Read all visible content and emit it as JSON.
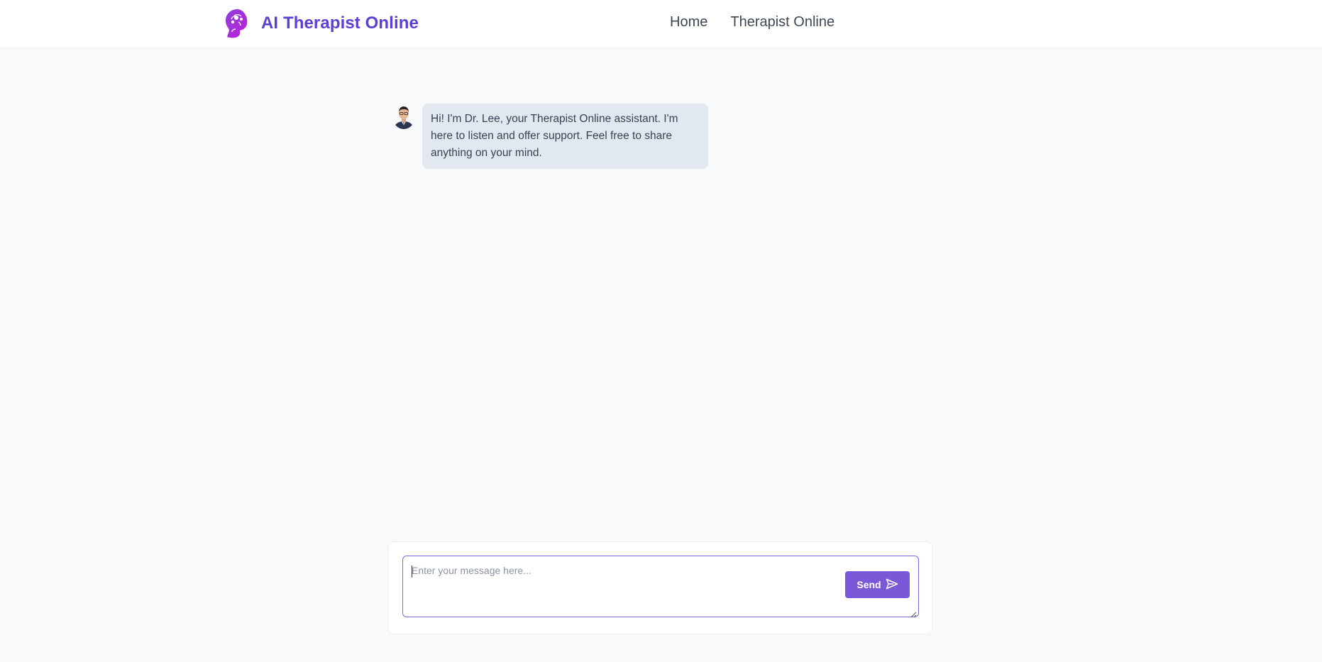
{
  "header": {
    "brand_title": "AI Therapist Online",
    "logo_icon": "brain-head-icon",
    "nav": [
      {
        "label": "Home"
      },
      {
        "label": "Therapist Online"
      }
    ]
  },
  "chat": {
    "messages": [
      {
        "sender": "assistant",
        "avatar_icon": "therapist-avatar",
        "text": "Hi! I'm Dr. Lee, your Therapist Online assistant. I'm here to listen and offer support. Feel free to share anything on your mind."
      }
    ]
  },
  "composer": {
    "placeholder": "Enter your message here...",
    "value": "",
    "send_label": "Send",
    "send_icon": "send-arrow-icon"
  },
  "colors": {
    "brand": "#5b3fd6",
    "send_button": "#7a58d8",
    "bubble": "#e2e8f0",
    "page_bg": "#f8f9fb"
  }
}
